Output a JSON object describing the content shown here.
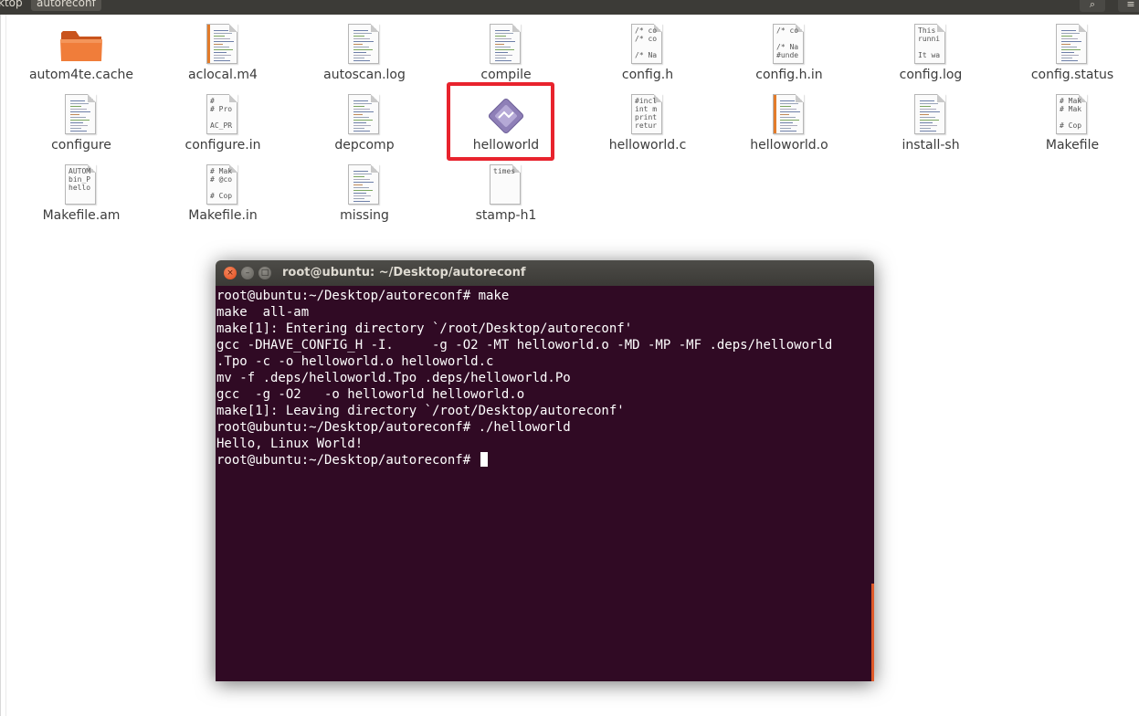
{
  "topbar": {
    "breadcrumbs": [
      "ktop",
      "autoreconf"
    ],
    "search_icon": "search-icon",
    "menu_icon": "menu-icon"
  },
  "files": [
    {
      "name": "autom4te.cache",
      "kind": "folder",
      "preview": ""
    },
    {
      "name": "aclocal.m4",
      "kind": "text-stripe",
      "preview": ""
    },
    {
      "name": "autoscan.log",
      "kind": "text",
      "preview": ""
    },
    {
      "name": "compile",
      "kind": "script",
      "preview": ""
    },
    {
      "name": "config.h",
      "kind": "preview",
      "preview": "/* co\n/* co\n\n/* Na"
    },
    {
      "name": "config.h.in",
      "kind": "preview",
      "preview": "/* co\n\n/* Na\n#unde"
    },
    {
      "name": "config.log",
      "kind": "preview",
      "preview": "This\nrunni\n\nIt wa"
    },
    {
      "name": "config.status",
      "kind": "script",
      "preview": ""
    },
    {
      "name": "configure",
      "kind": "script",
      "preview": ""
    },
    {
      "name": "configure.in",
      "kind": "preview",
      "preview": "#\n# Pro\n\nAC_PR"
    },
    {
      "name": "depcomp",
      "kind": "script",
      "preview": ""
    },
    {
      "name": "helloworld",
      "kind": "executable",
      "preview": ""
    },
    {
      "name": "helloworld.c",
      "kind": "preview",
      "preview": "#incl\nint m\nprint\nretur"
    },
    {
      "name": "helloworld.o",
      "kind": "text-stripe",
      "preview": ""
    },
    {
      "name": "install-sh",
      "kind": "script",
      "preview": ""
    },
    {
      "name": "Makefile",
      "kind": "preview",
      "preview": "# Mak\n# Mak\n\n# Cop"
    },
    {
      "name": "Makefile.am",
      "kind": "preview",
      "preview": "AUTOM\nbin_P\nhello"
    },
    {
      "name": "Makefile.in",
      "kind": "preview",
      "preview": "# Mak\n# @co\n\n# Cop"
    },
    {
      "name": "missing",
      "kind": "script",
      "preview": ""
    },
    {
      "name": "stamp-h1",
      "kind": "preview",
      "preview": "times"
    }
  ],
  "terminal": {
    "title": "root@ubuntu: ~/Desktop/autoreconf",
    "lines": [
      "root@ubuntu:~/Desktop/autoreconf# make",
      "make  all-am",
      "make[1]: Entering directory `/root/Desktop/autoreconf'",
      "gcc -DHAVE_CONFIG_H -I.     -g -O2 -MT helloworld.o -MD -MP -MF .deps/helloworld",
      ".Tpo -c -o helloworld.o helloworld.c",
      "mv -f .deps/helloworld.Tpo .deps/helloworld.Po",
      "gcc  -g -O2   -o helloworld helloworld.o",
      "make[1]: Leaving directory `/root/Desktop/autoreconf'",
      "root@ubuntu:~/Desktop/autoreconf# ./helloworld",
      "Hello, Linux World!",
      "root@ubuntu:~/Desktop/autoreconf# "
    ],
    "close_glyph": "×",
    "min_glyph": "–",
    "max_glyph": "□"
  },
  "colors": {
    "terminal_bg": "#300a24",
    "highlight": "#e8232d",
    "titlebar": "#3c3b37"
  }
}
